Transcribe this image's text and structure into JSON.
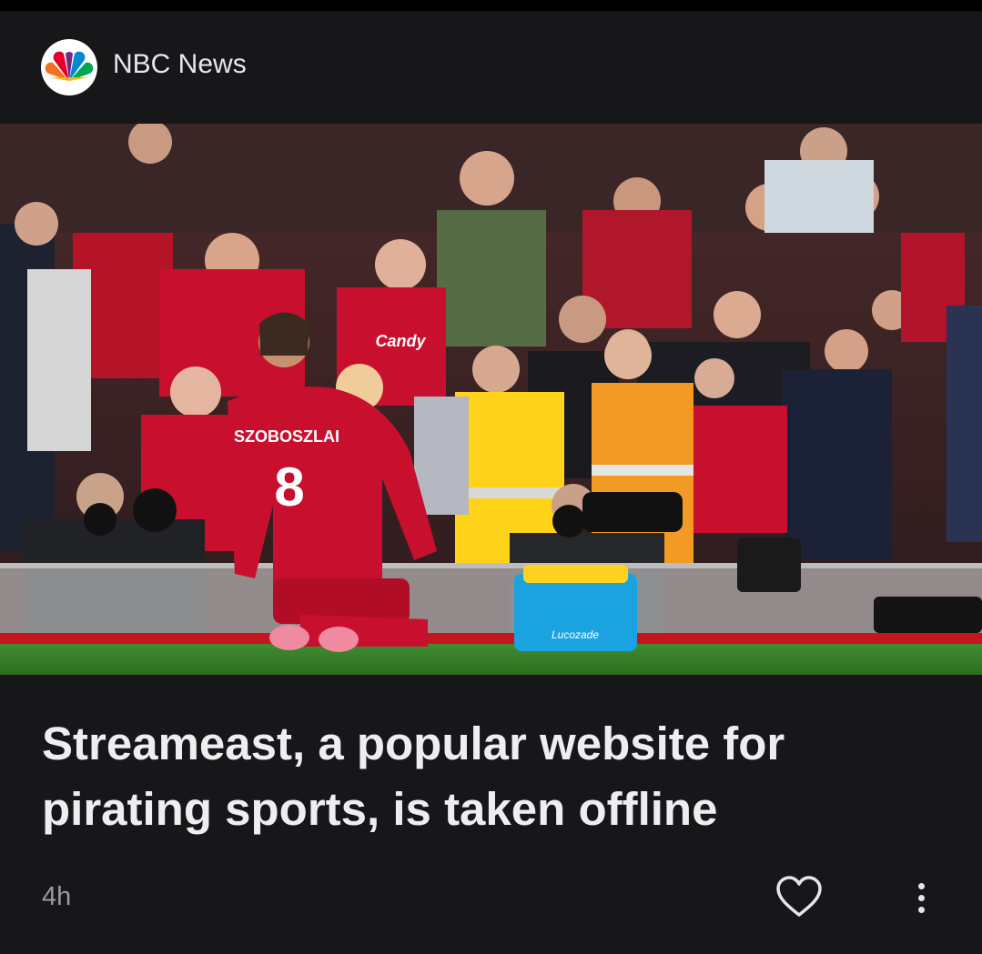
{
  "publisher": {
    "name": "NBC News",
    "logo_icon": "nbc-peacock-icon"
  },
  "article": {
    "image_alt": "Liverpool player kneeling in celebration in front of cheering fans and photographers",
    "headline_line1": "Streameast, a popular website for",
    "headline_line2": "pirating sports, is taken offline",
    "age": "4h"
  },
  "photo_text": {
    "player_name": "SZOBOSZLAI",
    "player_number": "8",
    "cooler_brand": "Lucozade",
    "shirt_sponsor": "Candy"
  },
  "actions": {
    "like_icon": "heart-outline-icon",
    "more_icon": "more-vertical-icon"
  },
  "colors": {
    "card_bg": "#17171a",
    "text": "#eeeef0",
    "muted": "#9a9aa0",
    "jersey_red": "#c8102e"
  }
}
